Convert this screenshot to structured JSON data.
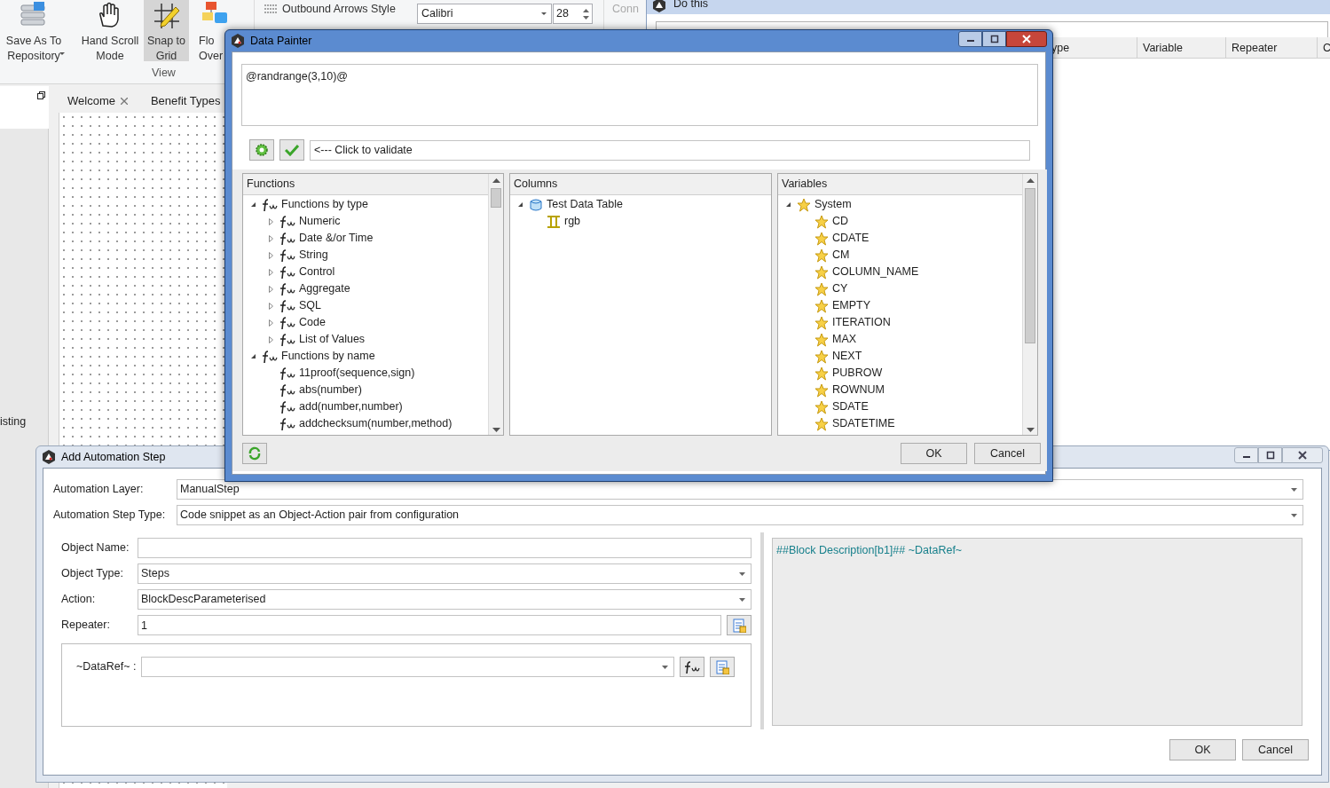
{
  "ribbon": {
    "buttons": [
      {
        "label": "Save As To Repository",
        "dropdown": true,
        "selected": false
      },
      {
        "label": "Hand Scroll Mode",
        "dropdown": false,
        "selected": false
      },
      {
        "label": "Snap to Grid",
        "dropdown": false,
        "selected": true
      },
      {
        "label": "Flo Over",
        "dropdown": false,
        "selected": false
      }
    ],
    "group_label": "View",
    "arrows_style": "Outbound Arrows Style",
    "font": "Calibri",
    "font_size": "28",
    "connect": "Conn"
  },
  "doc_tabs": [
    {
      "label": "Welcome",
      "closable": true
    },
    {
      "label": "Benefit Types",
      "closable": false
    }
  ],
  "left_panel_text": "isting",
  "do_this": {
    "title": "Do this",
    "columns": [
      "ype",
      "Variable",
      "Repeater",
      "C"
    ]
  },
  "data_painter": {
    "title": "Data Painter",
    "expression": "@randrange(3,10)@",
    "validate_text": "<--- Click to validate",
    "panels": [
      {
        "title": "Functions",
        "items": [
          {
            "label": "Functions by type",
            "expanded": true,
            "children": [
              {
                "label": "Numeric",
                "expanded": false
              },
              {
                "label": "Date &/or Time",
                "expanded": false
              },
              {
                "label": "String",
                "expanded": false
              },
              {
                "label": "Control",
                "expanded": false
              },
              {
                "label": "Aggregate",
                "expanded": false
              },
              {
                "label": "SQL",
                "expanded": false
              },
              {
                "label": "Code",
                "expanded": false
              },
              {
                "label": "List of Values",
                "expanded": false
              }
            ]
          },
          {
            "label": "Functions by name",
            "expanded": true,
            "children": [
              {
                "label": "11proof(sequence,sign)"
              },
              {
                "label": "abs(number)"
              },
              {
                "label": "add(number,number)"
              },
              {
                "label": "addchecksum(number,method)"
              }
            ]
          }
        ]
      },
      {
        "title": "Columns",
        "items": [
          {
            "label": "Test Data Table",
            "expanded": true,
            "children": [
              {
                "label": "rgb"
              }
            ]
          }
        ]
      },
      {
        "title": "Variables",
        "items": [
          {
            "label": "System",
            "expanded": true,
            "children": [
              {
                "label": "CD"
              },
              {
                "label": "CDATE"
              },
              {
                "label": "CM"
              },
              {
                "label": "COLUMN_NAME"
              },
              {
                "label": "CY"
              },
              {
                "label": "EMPTY"
              },
              {
                "label": "ITERATION"
              },
              {
                "label": "MAX"
              },
              {
                "label": "NEXT"
              },
              {
                "label": "PUBROW"
              },
              {
                "label": "ROWNUM"
              },
              {
                "label": "SDATE"
              },
              {
                "label": "SDATETIME"
              }
            ]
          }
        ]
      }
    ],
    "buttons": [
      "OK",
      "Cancel"
    ]
  },
  "automation_step": {
    "title": "Add Automation Step",
    "layer_label": "Automation Layer:",
    "layer": "ManualStep",
    "type_label": "Automation Step Type:",
    "type": "Code snippet as an Object-Action pair from configuration",
    "object_name_label": "Object Name:",
    "object_type_label": "Object Type:",
    "object_type": "Steps",
    "action_label": "Action:",
    "action": "BlockDescParameterised",
    "repeater_label": "Repeater:",
    "repeater": "1",
    "dataref_label": "~DataRef~ :",
    "preview": "##Block Description[b1]## ~DataRef~",
    "buttons": [
      "OK",
      "Cancel"
    ]
  }
}
